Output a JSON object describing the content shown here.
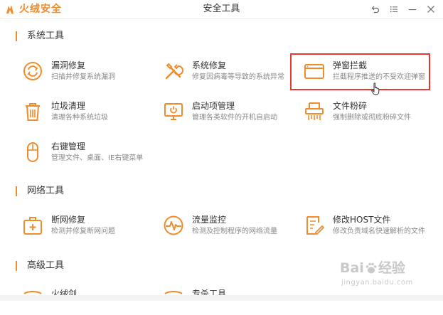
{
  "app": {
    "brand": "火绒安全",
    "window_title": "安全工具",
    "accent_color": "#f08c2c",
    "controls": [
      "back-icon",
      "menu-icon",
      "minimize-icon",
      "close-icon"
    ]
  },
  "sections": {
    "system": {
      "title": "系统工具",
      "tools": [
        {
          "name": "漏洞修复",
          "desc": "扫描并修复系统漏洞",
          "icon": "shield-refresh-icon"
        },
        {
          "name": "系统修复",
          "desc": "修复因病毒等导致的系统异常",
          "icon": "wrench-screwdriver-icon"
        },
        {
          "name": "弹窗拦截",
          "desc": "拦截程序推送的不受欢迎弹窗",
          "icon": "popup-window-icon"
        },
        {
          "name": "垃圾清理",
          "desc": "清理各种系统垃圾",
          "icon": "trash-icon"
        },
        {
          "name": "启动项管理",
          "desc": "管理各类软件的开机自启动",
          "icon": "monitor-startup-icon"
        },
        {
          "name": "文件粉碎",
          "desc": "强制删除或彻底粉碎文件",
          "icon": "shredder-icon"
        },
        {
          "name": "右键管理",
          "desc": "管理文件、桌面、IE右键菜单",
          "icon": "mouse-icon"
        }
      ]
    },
    "network": {
      "title": "网络工具",
      "tools": [
        {
          "name": "断网修复",
          "desc": "检测并修复断网问题",
          "icon": "first-aid-kit-icon"
        },
        {
          "name": "流量监控",
          "desc": "检测及控制程序的网络流量",
          "icon": "pulse-monitor-icon"
        },
        {
          "name": "修改HOST文件",
          "desc": "修改负责域名快速解析的文件",
          "icon": "edit-document-icon"
        }
      ]
    },
    "advanced": {
      "title": "高级工具",
      "tools": [
        {
          "name": "火绒剑",
          "icon": "sword-icon"
        },
        {
          "name": "专杀工具",
          "icon": "toolbox-icon"
        }
      ]
    }
  },
  "watermark": {
    "main_left": "Bai",
    "main_right": "经验",
    "paw_icon": "baidu-paw-icon",
    "sub": "jingyan.baidu.com"
  }
}
